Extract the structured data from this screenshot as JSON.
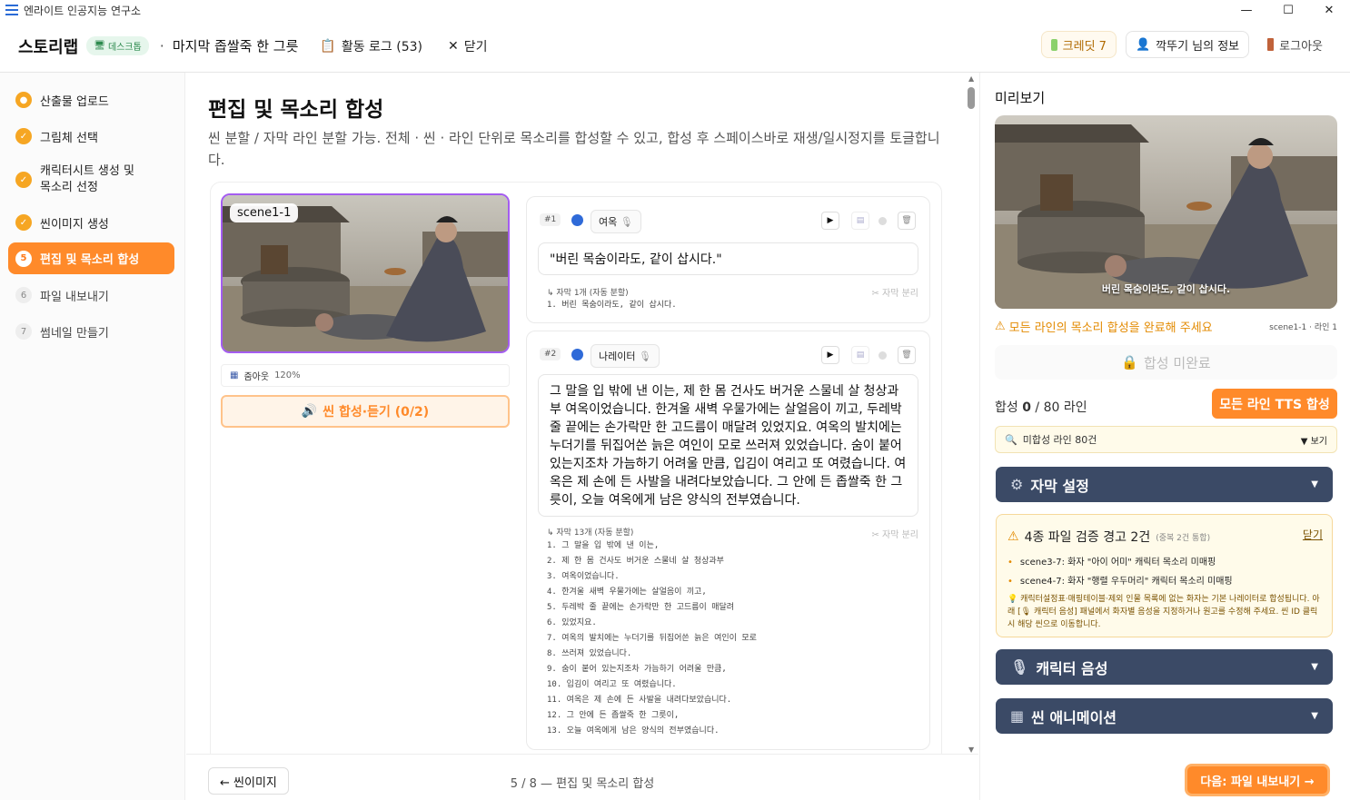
{
  "window": {
    "title": "엔라이트 인공지능 연구소",
    "min": "—",
    "max": "☐",
    "close": "✕"
  },
  "header": {
    "brand": "스토리랩",
    "desk_badge": "데스크톱",
    "sep": "·",
    "project_title": "마지막 좁쌀죽 한 그릇",
    "activity_log": "활동 로그 (53)",
    "close": "닫기",
    "credit": "크레딧 7",
    "user_info": "깍뚜기 님의 정보",
    "logout": "로그아웃"
  },
  "sidebar": {
    "items": [
      {
        "label": "산출물 업로드",
        "marker": "●",
        "state": "done"
      },
      {
        "label": "그림체 선택",
        "marker": "✓",
        "state": "done"
      },
      {
        "label": "캐릭터시트 생성 및 목소리 선정",
        "marker": "✓",
        "state": "done"
      },
      {
        "label": "씬이미지 생성",
        "marker": "✓",
        "state": "done"
      },
      {
        "label": "편집 및 목소리 합성",
        "marker": "5",
        "state": "current"
      },
      {
        "label": "파일 내보내기",
        "marker": "6",
        "state": "todo"
      },
      {
        "label": "썸네일 만들기",
        "marker": "7",
        "state": "todo"
      }
    ]
  },
  "main": {
    "title": "편집 및 목소리 합성",
    "description": "씬 분할 / 자막 라인 분할 가능. 전체 · 씬 · 라인 단위로 목소리를 합성할 수 있고, 합성 후 스페이스바로 재생/일시정지를 토글합니다.",
    "scene": {
      "label": "scene1-1",
      "zoom_label": "줌아웃",
      "zoom_value": "120%",
      "synth_button": "씬 합성·듣기 (0/2)"
    },
    "lines": [
      {
        "num": "#1",
        "speaker": "여옥",
        "text": "\"버린 목숨이라도, 같이 삽시다.\"",
        "sub_head": "↳ 자막 1개 (자동 분할)",
        "split": "자막 분리",
        "subs": "1. 버린 목숨이라도, 같이 삽시다."
      },
      {
        "num": "#2",
        "speaker": "나레이터",
        "text": "그 말을 입 밖에 낸 이는, 제 한 몸 건사도 버거운 스물네 살 청상과부 여옥이었습니다. 한겨울 새벽 우물가에는 살얼음이 끼고, 두레박 줄 끝에는 손가락만 한 고드름이 매달려 있었지요. 여옥의 발치에는 누더기를 뒤집어쓴 늙은 여인이 모로 쓰러져 있었습니다. 숨이 붙어 있는지조차 가늠하기 어려울 만큼, 입김이 여리고 또 여렸습니다. 여옥은 제 손에 든 사발을 내려다보았습니다. 그 안에 든 좁쌀죽 한 그릇이, 오늘 여옥에게 남은 양식의 전부였습니다.",
        "sub_head": "↳ 자막 13개 (자동 분할)",
        "split": "자막 분리",
        "subs": "1. 그 말을 입 밖에 낸 이는,\n2. 제 한 몸 건사도 버거운 스물네 살 청상과부\n3. 여옥이었습니다.\n4. 한겨울 새벽 우물가에는 살얼음이 끼고,\n5. 두레박 줄 끝에는 손가락만 한 고드름이 매달려\n6. 있었지요.\n7. 여옥의 발치에는 누더기를 뒤집어쓴 늙은 여인이 모로\n8. 쓰러져 있었습니다.\n9. 숨이 붙어 있는지조차 가늠하기 어려울 만큼,\n10. 입김이 여리고 또 여렸습니다.\n11. 여옥은 제 손에 든 사발을 내려다보았습니다.\n12. 그 안에 든 좁쌀죽 한 그릇이,\n13. 오늘 여옥에게 남은 양식의 전부였습니다."
      }
    ]
  },
  "preview": {
    "title": "미리보기",
    "caption": "버린 목숨이라도, 같이 삽시다.",
    "warning": "모든 라인의 목소리 합성을 완료해 주세요",
    "meta": "scene1-1 · 라인 1",
    "incomplete": "합성 미완료",
    "synth_prefix": "합성 ",
    "synth_count": "0",
    "synth_suffix": " / 80 라인",
    "tts_all": "모든 라인 TTS 합성",
    "unsynth": "미합성 라인 80건",
    "view": "▼ 보기",
    "subtitle_settings": "자막 설정",
    "file_warn_title": "4종 파일 검증 경고 2건",
    "file_warn_small": "(중복 2건 통합)",
    "file_warn_close": "닫기",
    "file_warn_items": [
      "scene3-7: 화자 \"아이 어미\" 캐릭터 목소리 미매핑",
      "scene4-7: 화자 \"행렬 우두머리\" 캐릭터 목소리 미매핑"
    ],
    "file_warn_note": "💡 캐릭터설정표·매핑테이블·제외 인물 목록에 없는 화자는 기본 나레이터로 합성됩니다. 아래 [🎙 캐릭터 음성] 패널에서 화자별 음성을 지정하거나 원고를 수정해 주세요. 씬 ID 클릭 시 해당 씬으로 이동합니다.",
    "char_voice": "캐릭터 음성",
    "scene_anim": "씬 애니메이션"
  },
  "footer": {
    "back": "← 씬이미지",
    "progress": "5 / 8 — 편집 및 목소리 합성",
    "next": "다음: 파일 내보내기 →"
  },
  "colors": {
    "accent": "#ff8a2a",
    "nav_dark": "#3b4a66",
    "selection": "#a45cf0"
  }
}
